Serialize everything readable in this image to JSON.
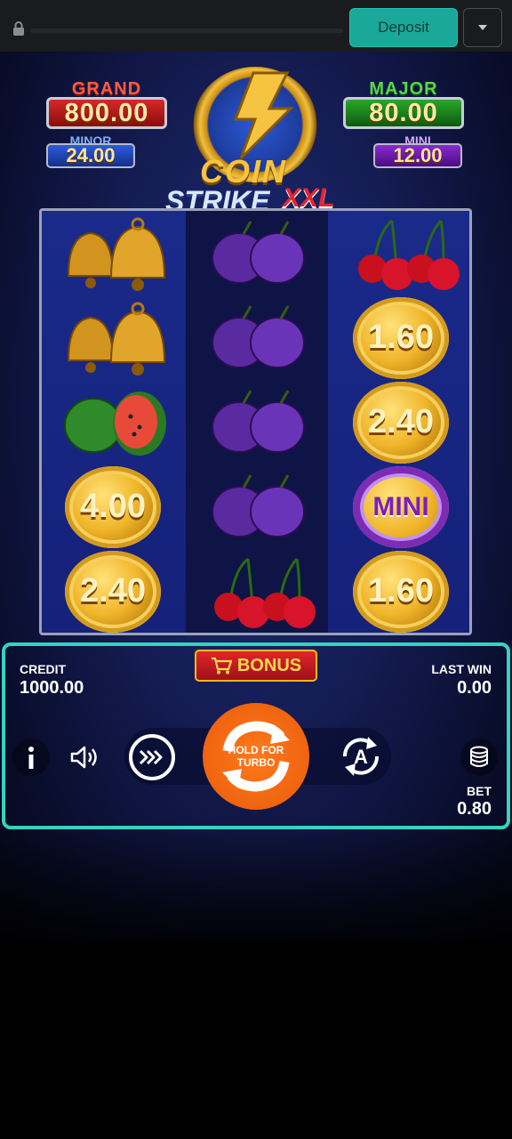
{
  "topbar": {
    "deposit_label": "Deposit"
  },
  "jackpots": {
    "grand": {
      "label": "GRAND",
      "value": "800.00"
    },
    "major": {
      "label": "MAJOR",
      "value": "80.00"
    },
    "minor": {
      "label": "MINOR",
      "value": "24.00"
    },
    "mini": {
      "label": "MINI",
      "value": "12.00"
    }
  },
  "logo": {
    "coin": "COIN",
    "strike": "STRIKE",
    "xxl": "XXL"
  },
  "reels": {
    "reel1": [
      "bell",
      "bell",
      "watermelon",
      "4.00",
      "2.40"
    ],
    "reel2": [
      "plum",
      "plum",
      "plum",
      "plum",
      "cherry"
    ],
    "reel3": [
      "cherry",
      "1.60",
      "2.40",
      "MINI",
      "1.60"
    ]
  },
  "controls": {
    "bonus_label": "BONUS",
    "credit_label": "CREDIT",
    "credit_value": "1000.00",
    "last_win_label": "LAST WIN",
    "last_win_value": "0.00",
    "turbo_label": "HOLD FOR TURBO",
    "bet_label": "BET",
    "bet_value": "0.80"
  },
  "colors": {
    "accent": "#34d3c1",
    "deposit": "#1aa89a",
    "spin": "#f06410"
  }
}
